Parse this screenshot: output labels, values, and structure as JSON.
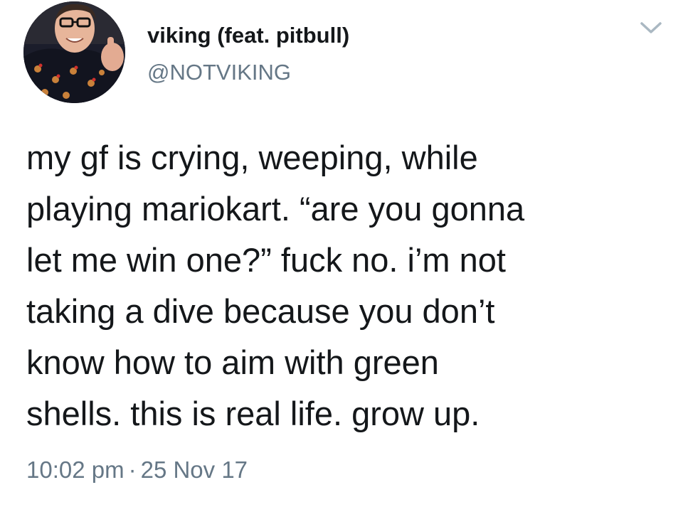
{
  "tweet": {
    "display_name": "viking (feat. pitbull)",
    "handle": "@NOTVIKING",
    "text_lines": [
      "my gf is crying, weeping, while",
      "playing mariokart. “are you gonna",
      "let me win one?” fuck no. i’m not",
      "taking a dive because you don’t",
      "know how to aim with green",
      "shells. this is real life. grow up."
    ],
    "time": "10:02 pm",
    "separator": "·",
    "date": "25 Nov 17"
  },
  "icons": {
    "avatar": "profile-photo",
    "menu": "chevron-down-icon"
  },
  "colors": {
    "text": "#14171a",
    "secondary": "#657786",
    "chevron": "#aab8c2"
  }
}
